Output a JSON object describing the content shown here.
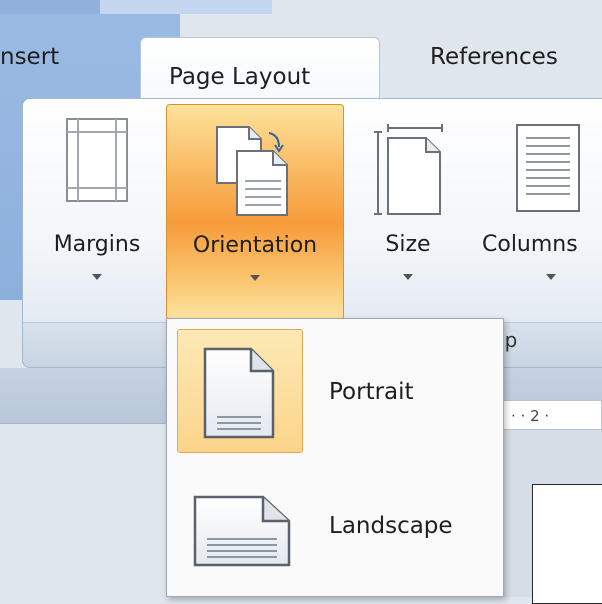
{
  "tabs": [
    {
      "label": "nsert",
      "active": false
    },
    {
      "label": "Page Layout",
      "active": true
    },
    {
      "label": "References",
      "active": false
    }
  ],
  "ribbon": {
    "buttons": [
      {
        "label": "Margins",
        "icon": "margins-icon"
      },
      {
        "label": "Orientation",
        "icon": "orientation-icon",
        "highlighted": true
      },
      {
        "label": "Size",
        "icon": "size-icon"
      },
      {
        "label": "Columns",
        "icon": "columns-icon"
      }
    ],
    "group_label": "up"
  },
  "orientation_menu": {
    "items": [
      {
        "label": "Portrait",
        "icon": "portrait-page-icon",
        "selected": true
      },
      {
        "label": "Landscape",
        "icon": "landscape-page-icon",
        "selected": false
      }
    ]
  },
  "ruler": {
    "text": "· · 2 ·"
  },
  "colors": {
    "accent_orange": "#f79b3b",
    "ribbon_border": "#a7b6c8",
    "selection": "#fbd48a"
  }
}
